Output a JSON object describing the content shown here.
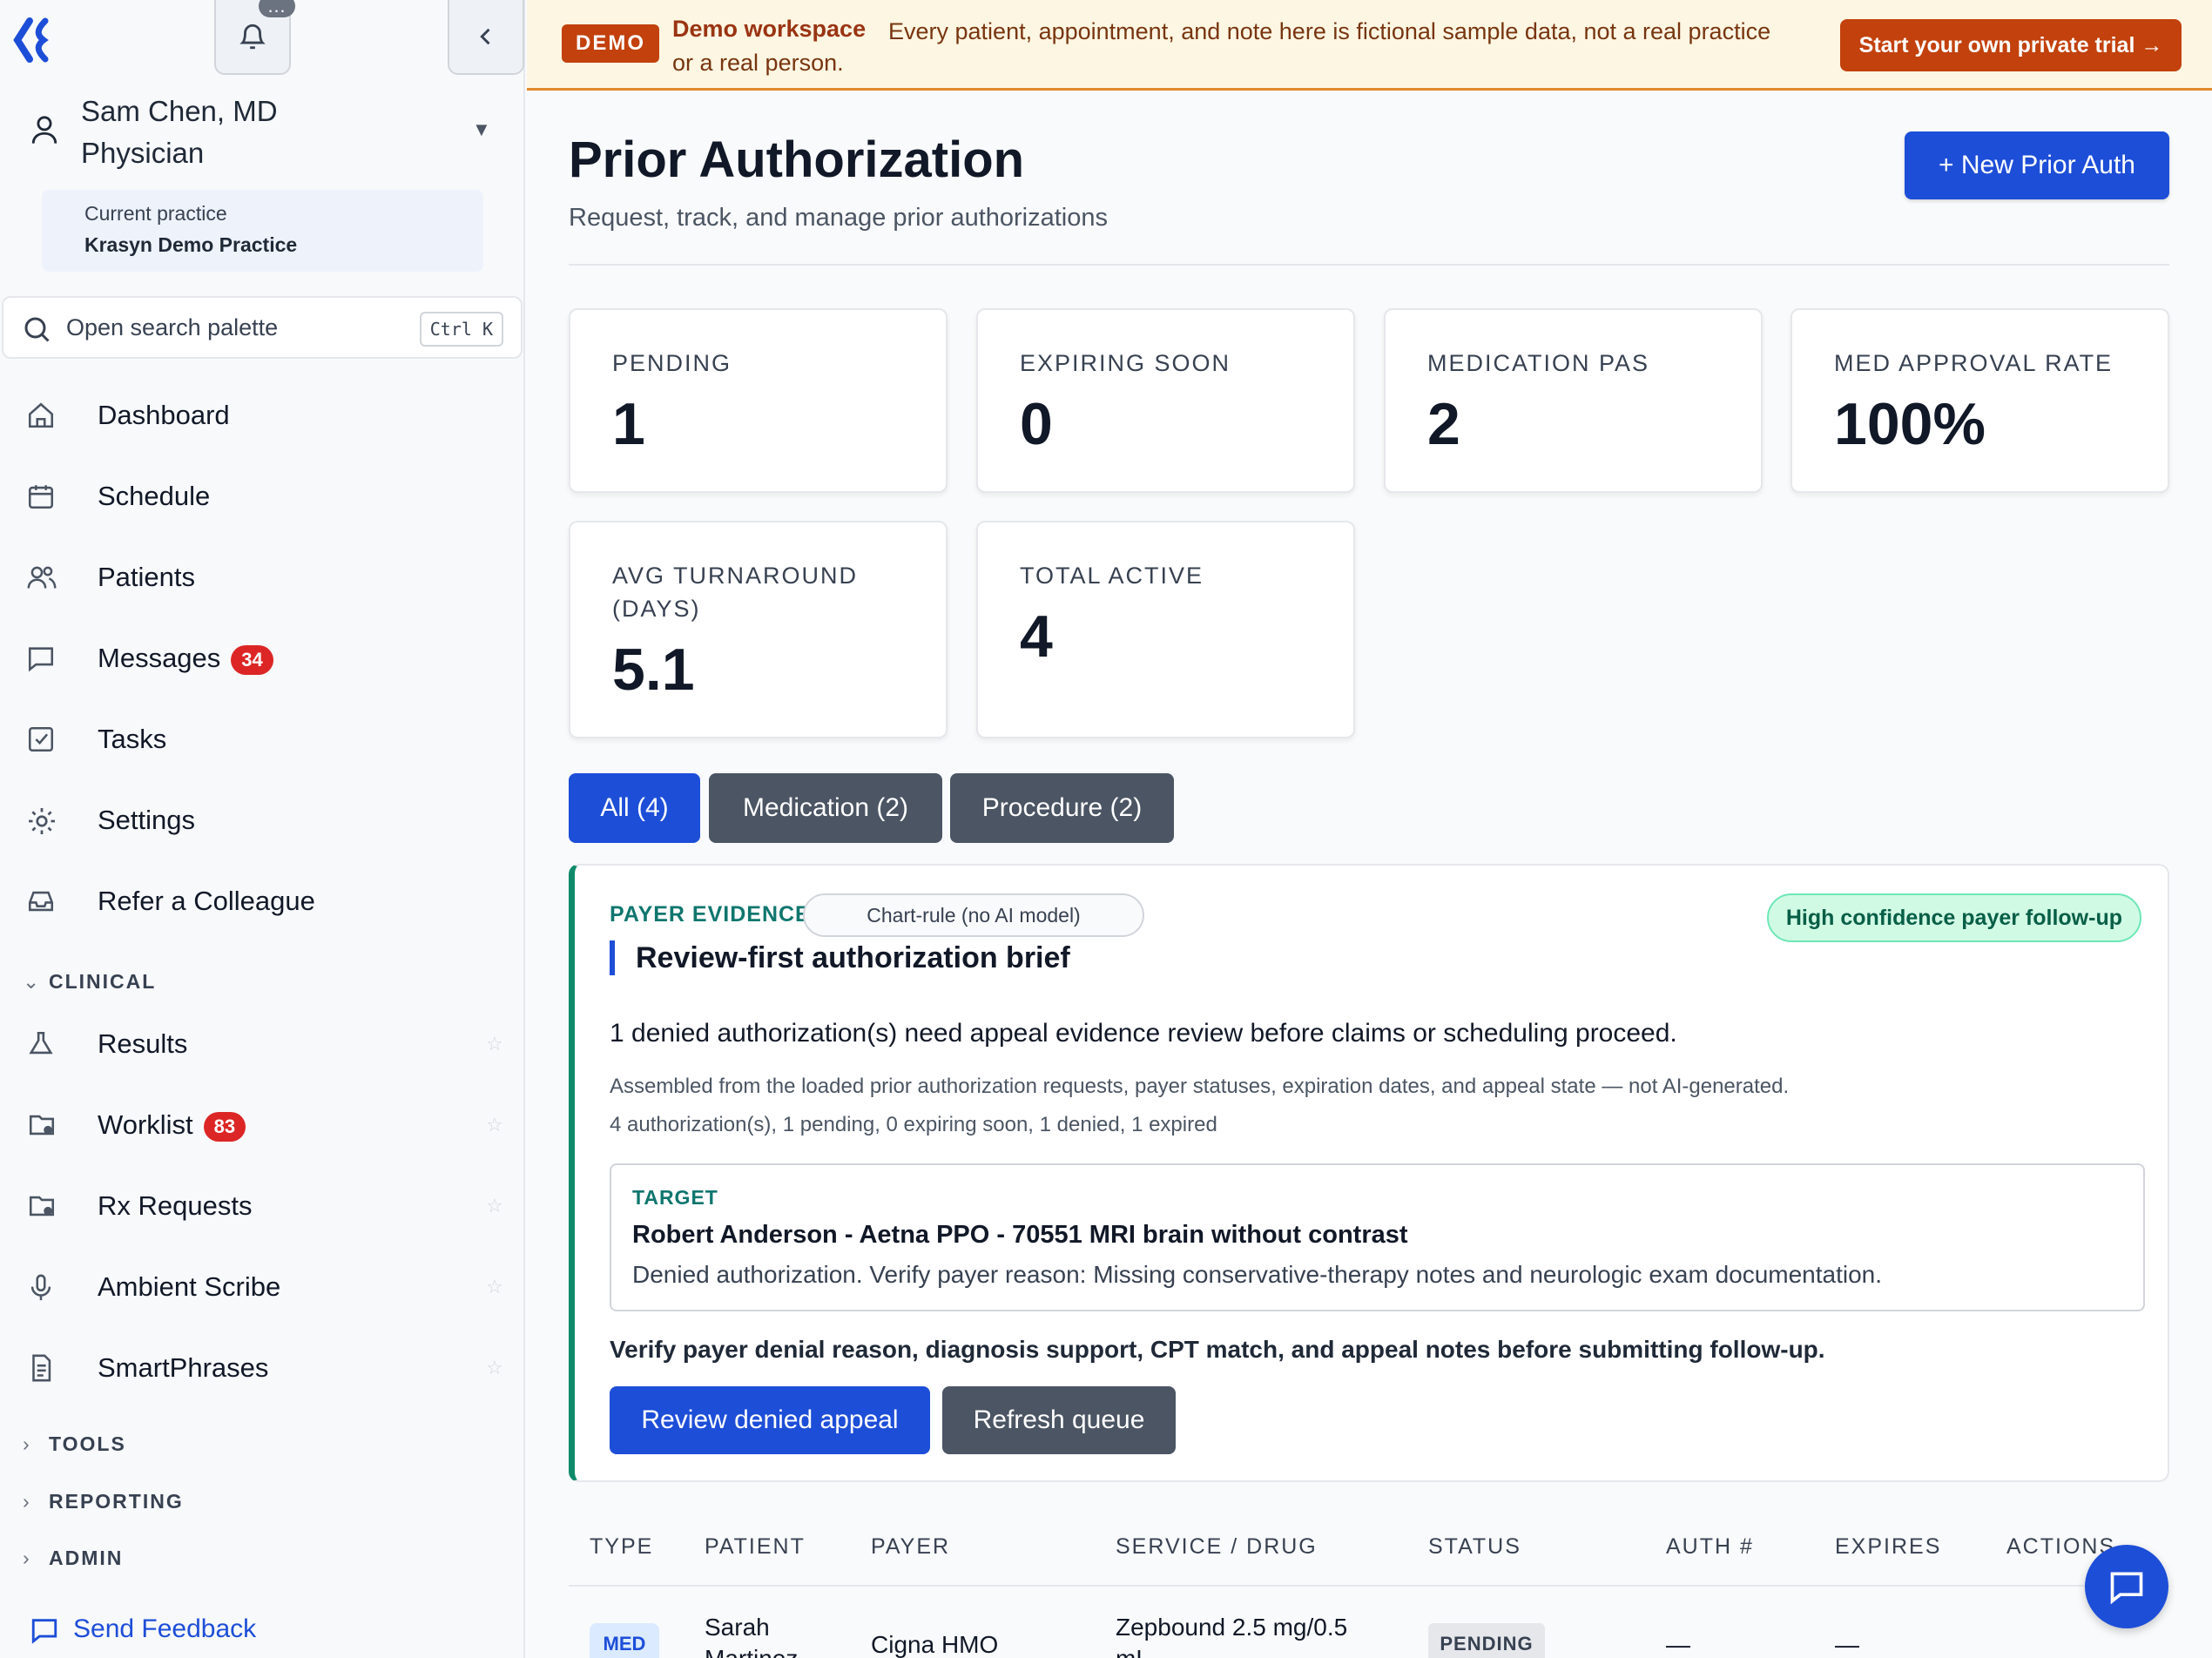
{
  "sidebar": {
    "notifications_badge": "…",
    "user": {
      "name": "Sam Chen, MD",
      "role": "Physician"
    },
    "practice": {
      "label": "Current practice",
      "name": "Krasyn Demo Practice"
    },
    "search": {
      "placeholder": "Open search palette",
      "shortcut": "Ctrl K"
    },
    "nav": [
      {
        "label": "Dashboard",
        "icon": "home-icon"
      },
      {
        "label": "Schedule",
        "icon": "calendar-icon"
      },
      {
        "label": "Patients",
        "icon": "users-icon"
      },
      {
        "label": "Messages",
        "icon": "message-icon",
        "badge": "34"
      },
      {
        "label": "Tasks",
        "icon": "checkbox-icon"
      },
      {
        "label": "Settings",
        "icon": "gear-icon"
      },
      {
        "label": "Refer a Colleague",
        "icon": "inbox-icon"
      }
    ],
    "clinical_heading": "CLINICAL",
    "clinical": [
      {
        "label": "Results",
        "icon": "flask-icon"
      },
      {
        "label": "Worklist",
        "icon": "folder-icon",
        "badge": "83"
      },
      {
        "label": "Rx Requests",
        "icon": "folder-icon"
      },
      {
        "label": "Ambient Scribe",
        "icon": "microphone-icon"
      },
      {
        "label": "SmartPhrases",
        "icon": "document-icon"
      }
    ],
    "sections": [
      "TOOLS",
      "REPORTING",
      "ADMIN"
    ],
    "feedback": "Send Feedback"
  },
  "banner": {
    "tag": "DEMO",
    "title": "Demo workspace",
    "text": "Every patient, appointment, and note here is fictional sample data, not a real practice or a real person.",
    "cta": "Start your own private trial →"
  },
  "header": {
    "title": "Prior Authorization",
    "subtitle": "Request, track, and manage prior authorizations",
    "new_button": "+ New Prior Auth"
  },
  "stats": [
    {
      "label": "PENDING",
      "value": "1"
    },
    {
      "label": "EXPIRING SOON",
      "value": "0"
    },
    {
      "label": "MEDICATION PAS",
      "value": "2"
    },
    {
      "label": "MED APPROVAL RATE",
      "value": "100%"
    },
    {
      "label": "AVG TURNAROUND (DAYS)",
      "value": "5.1"
    },
    {
      "label": "TOTAL ACTIVE",
      "value": "4"
    }
  ],
  "tabs": [
    {
      "label": "All (4)",
      "active": true
    },
    {
      "label": "Medication (2)",
      "active": false
    },
    {
      "label": "Procedure (2)",
      "active": false
    }
  ],
  "evidence": {
    "kicker": "PAYER EVIDENCE",
    "pill": "Chart-rule (no AI model)",
    "title": "Review-first authorization brief",
    "confidence": "High confidence payer follow-up",
    "summary": "1 denied authorization(s) need appeal evidence review before claims or scheduling proceed.",
    "note1": "Assembled from the loaded prior authorization requests, payer statuses, expiration dates, and appeal state — not AI-generated.",
    "note2": "4 authorization(s), 1 pending, 0 expiring soon, 1 denied, 1 expired",
    "target_label": "TARGET",
    "target_name": "Robert Anderson - Aetna PPO - 70551 MRI brain without contrast",
    "target_desc": "Denied authorization. Verify payer reason: Missing conservative-therapy notes and neurologic exam documentation.",
    "verify": "Verify payer denial reason, diagnosis support, CPT match, and appeal notes before submitting follow-up.",
    "primary_button": "Review denied appeal",
    "secondary_button": "Refresh queue"
  },
  "table": {
    "headers": [
      "TYPE",
      "PATIENT",
      "PAYER",
      "SERVICE / DRUG",
      "STATUS",
      "AUTH #",
      "EXPIRES",
      "ACTIONS"
    ],
    "rows": [
      {
        "type": "MED",
        "patient_first": "Sarah",
        "patient_last": "Martinez",
        "payer": "Cigna HMO",
        "service_line1": "Zepbound 2.5 mg/0.5",
        "service_line2": "mL",
        "status": "PENDING",
        "auth": "—",
        "expires": "—"
      }
    ]
  },
  "colors": {
    "accent": "#1d4ed8",
    "demo": "#c2410c",
    "evidence": "#0f8a6a",
    "badge": "#dc2626"
  }
}
